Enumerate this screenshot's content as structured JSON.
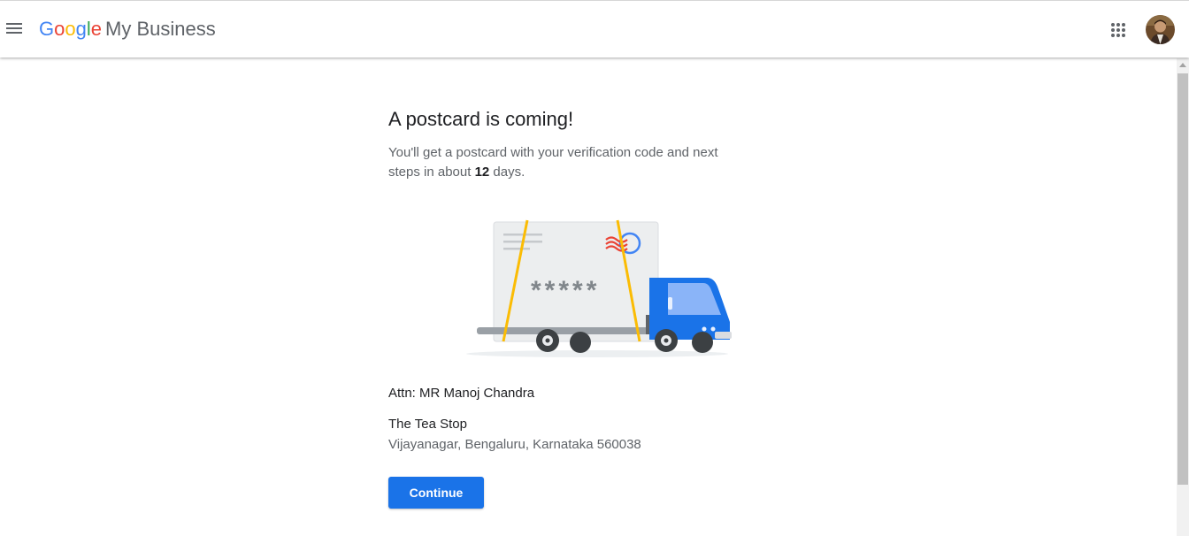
{
  "header": {
    "logo": {
      "letters": [
        "G",
        "o",
        "o",
        "g",
        "l",
        "e"
      ],
      "colors": [
        "#4285F4",
        "#EA4335",
        "#FBBC05",
        "#4285F4",
        "#34A853",
        "#EA4335"
      ]
    },
    "product_name": "My Business",
    "menu_icon": "hamburger-menu-icon",
    "apps_icon": "apps-grid-icon",
    "avatar_icon": "account-avatar"
  },
  "main": {
    "title": "A postcard is coming!",
    "description_before": "You'll get a postcard with your verification code and next steps in about ",
    "days": "12",
    "description_after": " days.",
    "illustration": {
      "code_mask": "*****",
      "icon": "postcard-delivery-truck-illustration"
    },
    "attention": "Attn: MR Manoj Chandra",
    "business_name": "The Tea Stop",
    "business_address": "Vijayanagar, Bengaluru, Karnataka 560038",
    "continue_label": "Continue"
  },
  "colors": {
    "primary": "#1a73e8",
    "text_primary": "#202124",
    "text_secondary": "#5f6368"
  }
}
